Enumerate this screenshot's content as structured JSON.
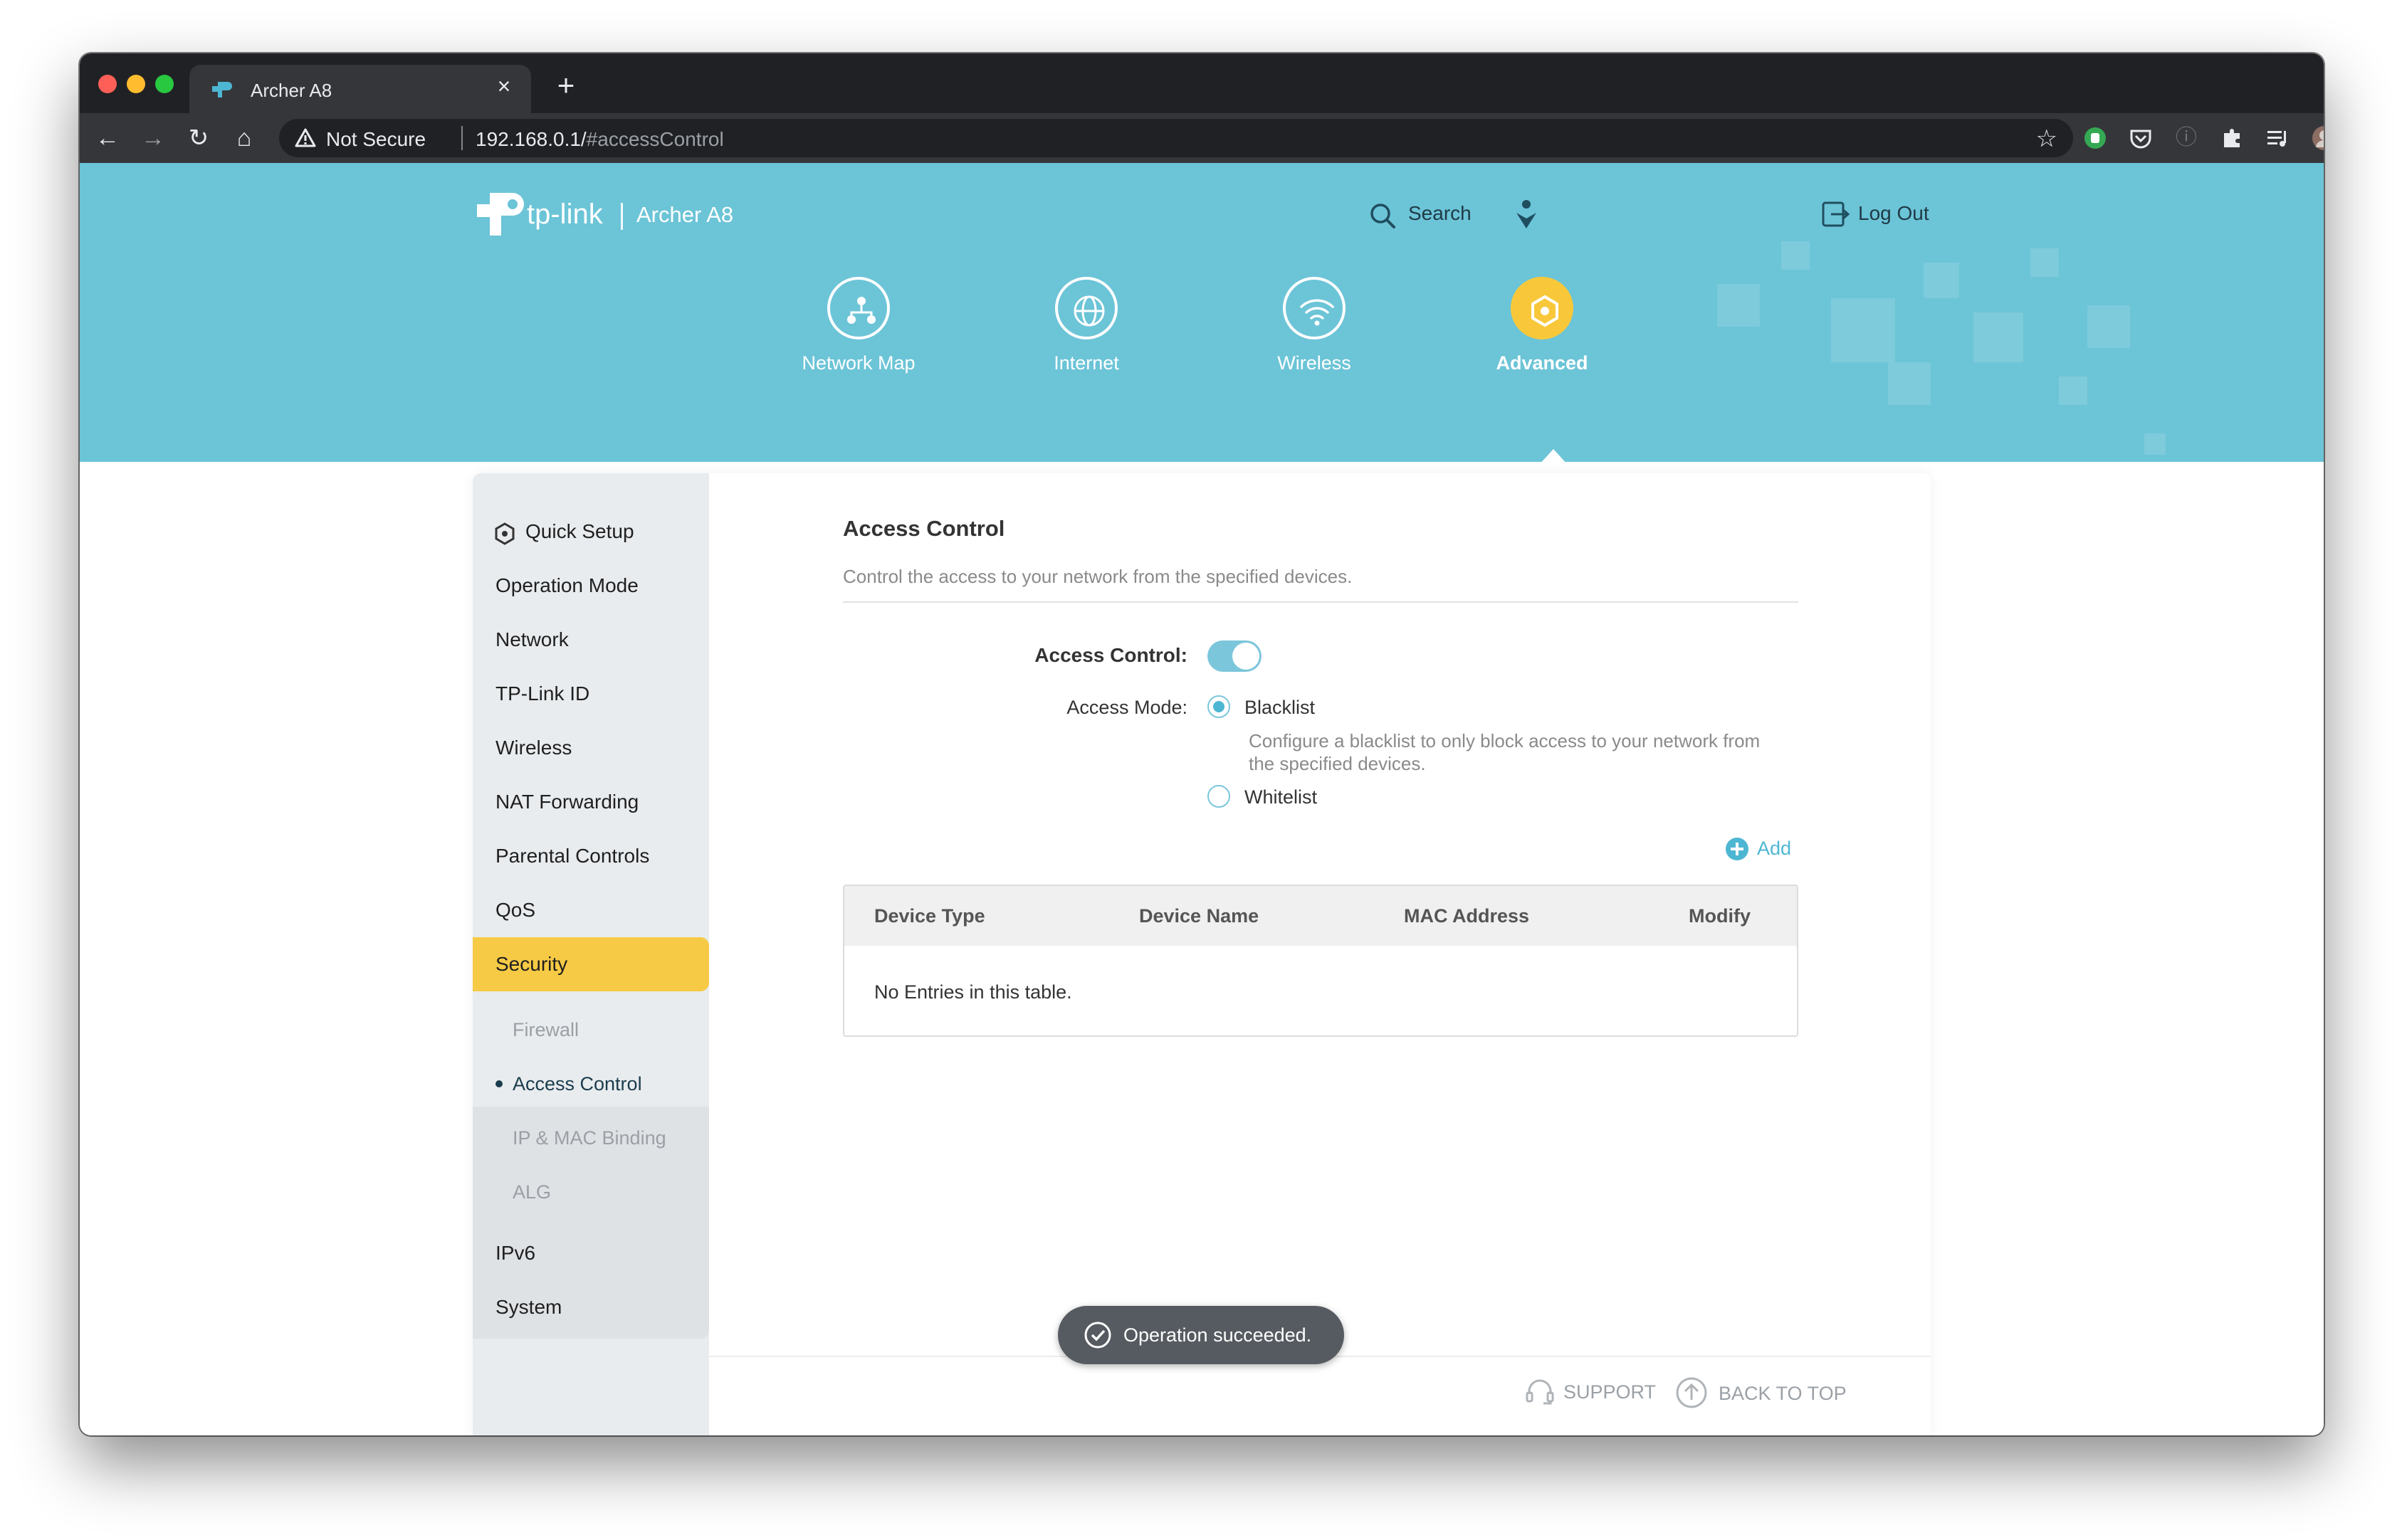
{
  "browser": {
    "tab_title": "Archer A8",
    "tab_close": "×",
    "new_tab": "+",
    "security_label": "Not Secure",
    "url_host": "192.168.0.1/",
    "url_path": "#accessControl"
  },
  "header": {
    "brand": "tp-link",
    "model": "Archer A8",
    "search_label": "Search",
    "logout_label": "Log Out"
  },
  "top_nav": [
    {
      "label": "Network Map",
      "icon": "network-map-icon"
    },
    {
      "label": "Internet",
      "icon": "globe-icon"
    },
    {
      "label": "Wireless",
      "icon": "wifi-icon"
    },
    {
      "label": "Advanced",
      "icon": "gear-icon",
      "active": true
    }
  ],
  "sidebar": {
    "items": [
      {
        "label": "Quick Setup"
      },
      {
        "label": "Operation Mode"
      },
      {
        "label": "Network"
      },
      {
        "label": "TP-Link ID"
      },
      {
        "label": "Wireless"
      },
      {
        "label": "NAT Forwarding"
      },
      {
        "label": "Parental Controls"
      },
      {
        "label": "QoS"
      },
      {
        "label": "Security",
        "active": true
      },
      {
        "label": "IPv6"
      },
      {
        "label": "System"
      }
    ],
    "security_sub": [
      {
        "label": "Firewall"
      },
      {
        "label": "Access Control",
        "active": true
      },
      {
        "label": "IP & MAC Binding"
      },
      {
        "label": "ALG"
      }
    ]
  },
  "main": {
    "title": "Access Control",
    "description": "Control the access to your network from the specified devices.",
    "access_control_label": "Access Control:",
    "access_control_enabled": true,
    "access_mode_label": "Access Mode:",
    "modes": [
      {
        "label": "Blacklist",
        "checked": true
      },
      {
        "label": "Whitelist",
        "checked": false
      }
    ],
    "blacklist_help": "Configure a blacklist to only block access to your network from the specified devices.",
    "add_label": "Add",
    "table": {
      "columns": [
        "Device Type",
        "Device Name",
        "MAC Address",
        "Modify"
      ],
      "empty_text": "No Entries in this table."
    }
  },
  "toast": {
    "text": "Operation succeeded."
  },
  "footer": {
    "support_label": "SUPPORT",
    "back_to_top_label": "BACK TO TOP"
  },
  "colors": {
    "banner": "#6cc4d7",
    "accent": "#4db7d3",
    "active_yellow": "#f7ca45",
    "toast_bg": "#555b60"
  }
}
